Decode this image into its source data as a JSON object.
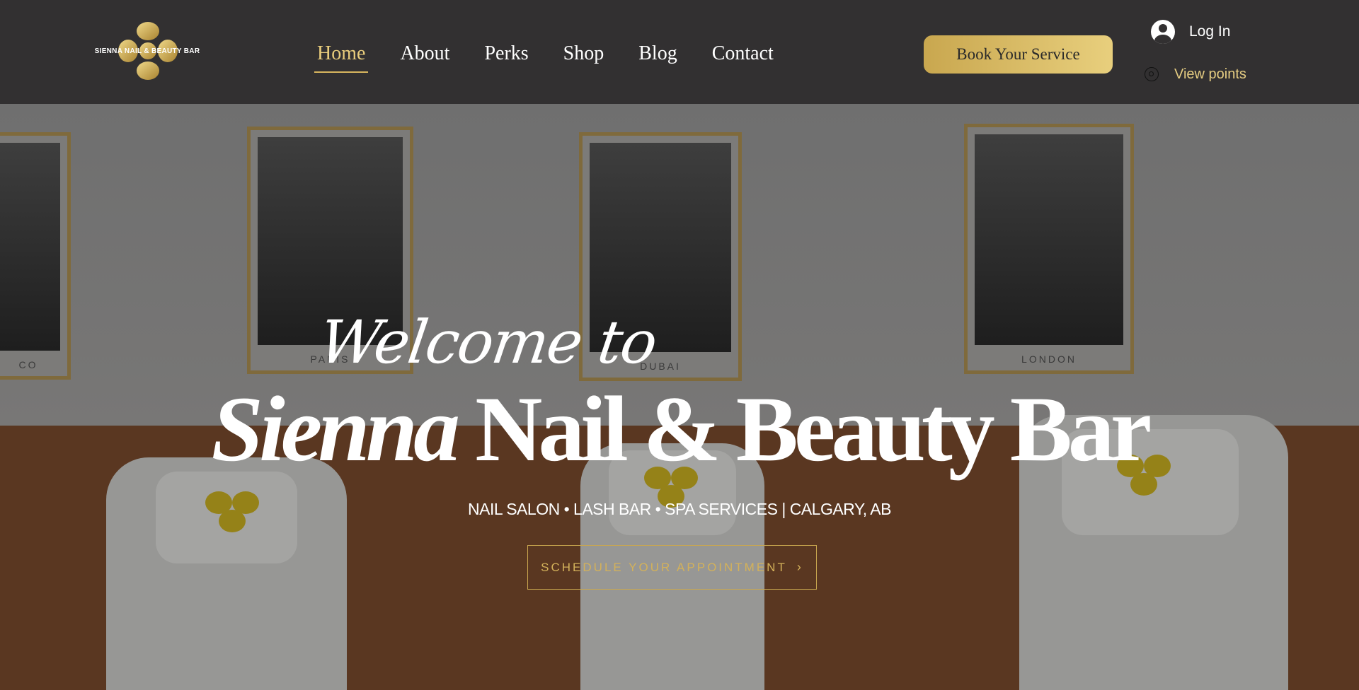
{
  "brand": {
    "logo_text": "SIENNA NAIL & BEAUTY BAR",
    "accent": "#d8b65e",
    "header_bg": "#323031"
  },
  "nav": {
    "items": [
      {
        "label": "Home",
        "active": true
      },
      {
        "label": "About"
      },
      {
        "label": "Perks"
      },
      {
        "label": "Shop"
      },
      {
        "label": "Blog"
      },
      {
        "label": "Contact"
      }
    ]
  },
  "header": {
    "book_label": "Book Your Service",
    "login_label": "Log In",
    "points_label": "View points"
  },
  "hero": {
    "welcome": "Welcome to",
    "title_italic": "Sienna",
    "title_rest": " Nail & Beauty Bar",
    "tagline": "NAIL SALON • LASH BAR • SPA SERVICES | CALGARY, AB",
    "cta_label": "SCHEDULE YOUR APPOINTMENT",
    "cta_icon": "chevron-right-icon",
    "frames": [
      "CO",
      "PARIS",
      "DUBAI",
      "LONDON"
    ],
    "chair_logo_text": "SIENNA NAIL & BEAUTY BAR"
  }
}
